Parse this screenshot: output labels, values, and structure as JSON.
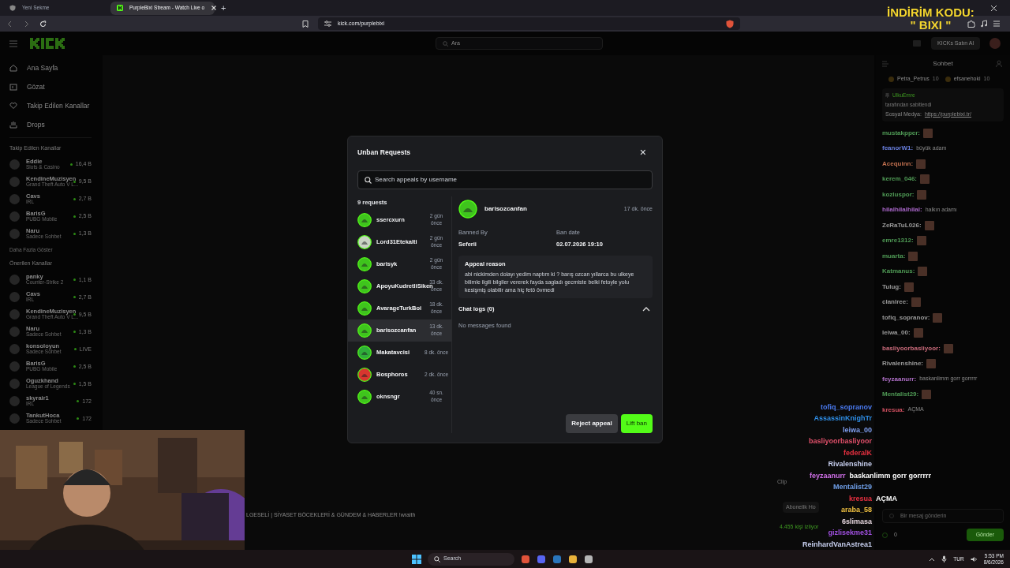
{
  "browser": {
    "tabs": [
      {
        "title": "Yeni Sekme",
        "selected": false
      },
      {
        "title": "PurpleBixi Stream - Watch Live o",
        "selected": true
      }
    ],
    "new_tab": "+",
    "url": "kick.com/purplebixi"
  },
  "promo_overlay": {
    "line_1": "İNDİRİM KODU:",
    "line_2": "\" BIXI \""
  },
  "site": {
    "search_placeholder": "Ara",
    "buy_button": "KICKs Satın Al"
  },
  "sidebar": {
    "nav": [
      {
        "label": "Ana Sayfa"
      },
      {
        "label": "Gözat"
      },
      {
        "label": "Takip Edilen Kanallar"
      },
      {
        "label": "Drops"
      }
    ],
    "followed_title": "Takip Edilen Kanallar",
    "followed": [
      {
        "name": "Eddie",
        "category": "Slots & Casino",
        "viewers": "16,4 B"
      },
      {
        "name": "KendineMuzisyen",
        "category": "Grand Theft Auto V L...",
        "viewers": "9,5 B"
      },
      {
        "name": "Cavs",
        "category": "IRL",
        "viewers": "2,7 B"
      },
      {
        "name": "BarisG",
        "category": "PUBG Mobile",
        "viewers": "2,5 B"
      },
      {
        "name": "Naru",
        "category": "Sadece Sohbet",
        "viewers": "1,3 B"
      }
    ],
    "show_more": "Daha Fazla Göster",
    "recommended_title": "Önerilen Kanallar",
    "recommended": [
      {
        "name": "panky",
        "category": "Counter-Strike 2",
        "viewers": "1,1 B"
      },
      {
        "name": "Cavs",
        "category": "IRL",
        "viewers": "2,7 B"
      },
      {
        "name": "KendineMuzisyen",
        "category": "Grand Theft Auto V L...",
        "viewers": "9,5 B"
      },
      {
        "name": "Naru",
        "category": "Sadece Sohbet",
        "viewers": "1,3 B"
      },
      {
        "name": "konsoloyun",
        "category": "Sadece Sohbet",
        "viewers": "LIVE"
      },
      {
        "name": "BarisG",
        "category": "PUBG Mobile",
        "viewers": "2,5 B"
      },
      {
        "name": "Oguzkhand",
        "category": "League of Legends",
        "viewers": "1,5 B"
      },
      {
        "name": "skyrair1",
        "category": "IRL",
        "viewers": "172"
      },
      {
        "name": "TankutHoca",
        "category": "Sadece Sohbet",
        "viewers": "172"
      }
    ]
  },
  "stream": {
    "ticker": "LGESELİ | SİYASET BÖCEKLERİ & GÜNDEM & HABERLER !wraith",
    "clip": "Clip",
    "subscription_gift": "Abonelik Ho",
    "viewers": "4.455 kişi izliyor"
  },
  "modal": {
    "title": "Unban Requests",
    "close": "×",
    "search_placeholder": "Search appeals by username",
    "count": "9 requests",
    "requests": [
      {
        "username": "ssercxurn",
        "time": "2 gün önce",
        "color": "#3fc41d",
        "selected": false
      },
      {
        "username": "Lord31Etekalti",
        "time": "2 gün önce",
        "color": "#c9d3c4",
        "selected": false
      },
      {
        "username": "barisyk",
        "time": "2 gün önce",
        "color": "#3fc41d",
        "selected": false
      },
      {
        "username": "ApoyuKudretliSiken",
        "time": "33 dk. önce",
        "color": "#3fc41d",
        "selected": false
      },
      {
        "username": "AvarageTurkBoi",
        "time": "18 dk. önce",
        "color": "#3fc41d",
        "selected": false
      },
      {
        "username": "barisozcanfan",
        "time": "13 dk. önce",
        "color": "#3fc41d",
        "selected": true
      },
      {
        "username": "Makatavcisi",
        "time": "8 dk. önce",
        "color": "#2fae3a",
        "selected": false
      },
      {
        "username": "Bosphoros",
        "time": "2 dk. önce",
        "color": "#d8362f",
        "selected": false
      },
      {
        "username": "oknsngr",
        "time": "40 sn. önce",
        "color": "#3fc41d",
        "selected": false
      }
    ],
    "detail": {
      "username": "barisozcanfan",
      "time": "17 dk. önce",
      "banned_by_label": "Banned By",
      "banned_by": "Seferii",
      "ban_date_label": "Ban date",
      "ban_date": "02.07.2026 19:10",
      "appeal_label": "Appeal reason",
      "appeal_text": "abi nickimden dolayı yedim naptım ki ? barış ozcan yıllarca bu ulkeye bilimle ilgili bilgiler vererek fayda sagladı gecmiste belki fetoyle yolu kesişmiş olabilir ama hiç fetö övmedi",
      "chat_logs_label": "Chat logs (0)",
      "chat_logs_expanded": true,
      "chat_logs_empty": "No messages found"
    },
    "buttons": [
      {
        "label": "Reject appeal",
        "kind": "secondary"
      },
      {
        "label": "Lift ban",
        "kind": "primary"
      }
    ]
  },
  "chat": {
    "title": "Sohbet",
    "gifters": [
      {
        "name": "Petra_Petrus",
        "count": "10"
      },
      {
        "name": "efsanehoki",
        "count": "10"
      }
    ],
    "pinned": {
      "user": "UlkuEmre",
      "note": "tarafından sabitlendi",
      "label": "Sosyal Medya:",
      "link": "https://purplebixi.tr/"
    },
    "messages": [
      {
        "user": "mustakpper:",
        "color": "#4f9a55",
        "emote": true
      },
      {
        "user": "feanorW1:",
        "color": "#6a80e0",
        "text": "büyük adam",
        "emote": false
      },
      {
        "user": "Acequinn:",
        "color": "#c0704f",
        "emote": true
      },
      {
        "user": "kerem_046:",
        "color": "#4f9a55",
        "emote": true
      },
      {
        "user": "kozluspor:",
        "color": "#4f9a55",
        "emote": true
      },
      {
        "user": "hilalhilalhilal:",
        "color": "#a866c8",
        "text": "halkın adamı",
        "emote": false
      },
      {
        "user": "ZeRaTuL026:",
        "color": "#9a9a9a",
        "emote": true
      },
      {
        "user": "emre1312:",
        "color": "#4f9a55",
        "emote": true
      },
      {
        "user": "muarta:",
        "color": "#4f9a55",
        "emote": true
      },
      {
        "user": "Katmanus:",
        "color": "#4f9a55",
        "emote": true
      },
      {
        "user": "Tulug:",
        "color": "#9a9a9a",
        "emote": true
      },
      {
        "user": "clanlree:",
        "color": "#9a9a9a",
        "emote": true
      },
      {
        "user": "tofiq_sopranov:",
        "color": "#9a9a9a",
        "emote": true
      },
      {
        "user": "leiwa_00:",
        "color": "#9a9a9a",
        "emote": true
      },
      {
        "user": "basliyoorbasliyoor:",
        "color": "#c86a7a",
        "emote": true
      },
      {
        "user": "Rivalenshine:",
        "color": "#9a9a9a",
        "emote": true
      },
      {
        "user": "feyzaanurr:",
        "color": "#b070c8",
        "text": "baskanlimm gorr gorrrrr",
        "emote": false
      },
      {
        "user": "Mentalist29:",
        "color": "#4f9a55",
        "emote": true
      },
      {
        "user": "kresua:",
        "color": "#d05060",
        "text": "AÇMA",
        "emote": false
      }
    ],
    "input_placeholder": "Bir mesaj gönderin",
    "points": "0",
    "send": "Gönder"
  },
  "overlay_chat": [
    {
      "user": "tofiq_sopranov",
      "color": "#4a7af0"
    },
    {
      "user": "AssassinKnighTr",
      "color": "#2f8fe8"
    },
    {
      "user": "leiwa_00",
      "color": "#7f9ff0"
    },
    {
      "user": "basliyoorbasliyoor",
      "color": "#e0506a"
    },
    {
      "user": "federalK",
      "color": "#e83040"
    },
    {
      "user": "Rivalenshine",
      "color": "#c8d0f0"
    },
    {
      "user": "feyzaanurr",
      "color": "#d070e8",
      "text": "baskanlimm gorr gorrrrr"
    },
    {
      "user": "Mentalist29",
      "color": "#6f9fe8"
    },
    {
      "user": "kresua",
      "color": "#e83040",
      "text": "AÇMA"
    },
    {
      "user": "araba_58",
      "color": "#f0c040"
    },
    {
      "user": "6slimasa",
      "color": "#e8d8e0"
    },
    {
      "user": "gizlisekme31",
      "color": "#a050e0"
    },
    {
      "user": "ReinhardVanAstrea1",
      "color": "#c8d0f0"
    }
  ],
  "taskbar": {
    "search": "Search",
    "language": "TUR",
    "time": "5:53 PM",
    "date": "8/6/2026"
  }
}
